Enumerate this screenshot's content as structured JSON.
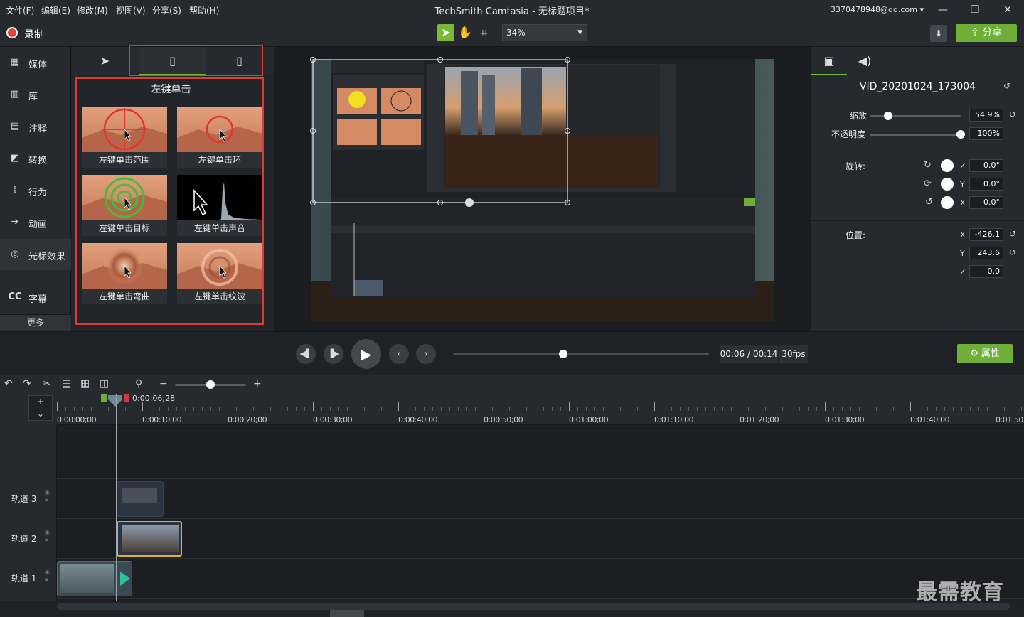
{
  "menu": [
    "文件(F)",
    "编辑(E)",
    "修改(M)",
    "视图(V)",
    "分享(S)",
    "帮助(H)"
  ],
  "window": {
    "title": "TechSmith Camtasia - 无标题项目*",
    "account": "3370478948@qq.com"
  },
  "toolbar": {
    "record_label": "录制",
    "zoom": "34%",
    "share_label": "分享"
  },
  "nav": [
    {
      "label": "媒体",
      "icon": "media-icon"
    },
    {
      "label": "库",
      "icon": "library-icon"
    },
    {
      "label": "注释",
      "icon": "annotation-icon"
    },
    {
      "label": "转换",
      "icon": "transition-icon"
    },
    {
      "label": "行为",
      "icon": "behavior-icon"
    },
    {
      "label": "动画",
      "icon": "animation-icon"
    },
    {
      "label": "光标效果",
      "icon": "cursor-effect-icon"
    },
    {
      "label": "字幕",
      "icon": "caption-icon"
    }
  ],
  "nav_more": "更多",
  "effects": {
    "title": "左键单击",
    "items": [
      {
        "label": "左键单击范围"
      },
      {
        "label": "左键单击环"
      },
      {
        "label": "左键单击目标"
      },
      {
        "label": "左键单击声音"
      },
      {
        "label": "左键单击弯曲"
      },
      {
        "label": "左键单击纹波"
      }
    ]
  },
  "props": {
    "clip_name": "VID_20201024_173004",
    "scale_label": "缩放",
    "scale": "54.9%",
    "scale_level": 0.2,
    "opacity_label": "不透明度",
    "opacity": "100%",
    "opacity_level": 1.0,
    "rotation_label": "旋转:",
    "rot_z": "0.0°",
    "rot_y": "0.0°",
    "rot_x": "0.0°",
    "position_label": "位置:",
    "pos_x": "-426.1",
    "pos_y": "243.6",
    "pos_z": "0.0",
    "axis_z": "Z",
    "axis_y": "Y",
    "axis_x": "X"
  },
  "playback": {
    "time": "00:06 / 00:14",
    "fps": "30fps",
    "progress": 0.43,
    "attr_label": "属性"
  },
  "timeline": {
    "playhead": "0:00:06;28",
    "ticks": [
      "0:00:00;00",
      "0:00:10;00",
      "0:00:20;00",
      "0:00:30;00",
      "0:00:40;00",
      "0:00:50;00",
      "0:01:00;00",
      "0:01:10;00",
      "0:01:20;00",
      "0:01:30;00",
      "0:01:40;00",
      "0:01:50;00"
    ],
    "tracks": [
      "轨道 3",
      "轨道 2",
      "轨道 1"
    ]
  },
  "watermark": "最需教育"
}
